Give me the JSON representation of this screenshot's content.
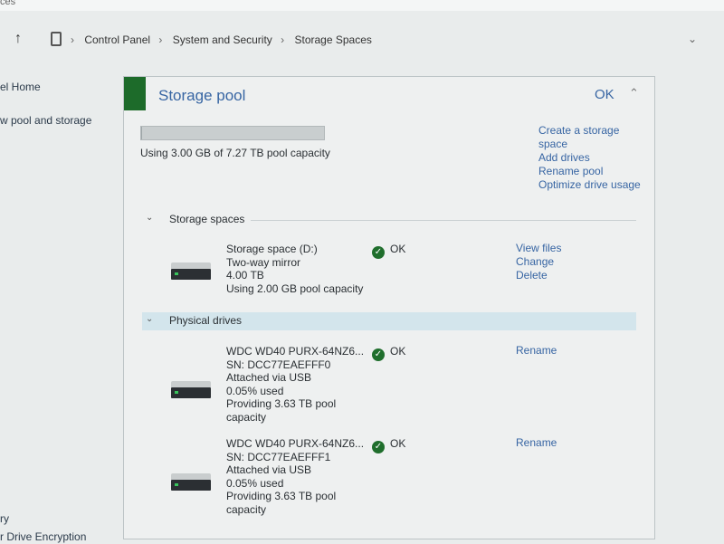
{
  "titlebar": {
    "fragment": "ces"
  },
  "address": {
    "crumbs": [
      "Control Panel",
      "System and Security",
      "Storage Spaces"
    ]
  },
  "leftnav": {
    "items": [
      "el Home",
      "w pool and storage",
      "ry",
      "r Drive Encryption"
    ]
  },
  "pool": {
    "title": "Storage pool",
    "status": "OK",
    "capacity_text": "Using 3.00 GB of 7.27 TB pool capacity",
    "capacity_fraction": 0.0004,
    "actions": [
      "Create a storage",
      "space",
      "Add drives",
      "Rename pool",
      "Optimize drive usage"
    ]
  },
  "storage_spaces": {
    "header": "Storage spaces",
    "items": [
      {
        "lines": [
          "Storage space (D:)",
          "Two-way mirror",
          "4.00 TB",
          "Using 2.00 GB pool capacity"
        ],
        "status": "OK",
        "actions": [
          "View files",
          "Change",
          "Delete"
        ]
      }
    ]
  },
  "physical_drives": {
    "header": "Physical drives",
    "items": [
      {
        "lines": [
          "WDC WD40 PURX-64NZ6...",
          "SN: DCC77EAEFFF0",
          "Attached via USB",
          "0.05% used",
          "Providing 3.63 TB pool",
          "capacity"
        ],
        "status": "OK",
        "action": "Rename"
      },
      {
        "lines": [
          "WDC WD40 PURX-64NZ6...",
          "SN: DCC77EAEFFF1",
          "Attached via USB",
          "0.05% used",
          "Providing 3.63 TB pool",
          "capacity"
        ],
        "status": "OK",
        "action": "Rename"
      }
    ]
  },
  "colors": {
    "link": "#3765a3",
    "accent_green": "#1d6b2a",
    "ok_check": "#1f6e2c"
  },
  "icons": [
    "up-arrow-icon",
    "storage-spaces-icon",
    "chevron-down-icon",
    "chevron-up-icon",
    "check-icon",
    "drive-icon"
  ]
}
